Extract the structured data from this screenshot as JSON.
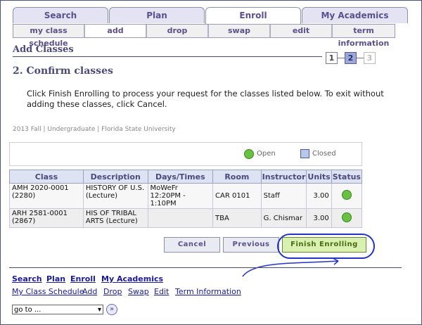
{
  "tabs": [
    {
      "label": "Search",
      "active": false
    },
    {
      "label": "Plan",
      "active": false
    },
    {
      "label": "Enroll",
      "active": true
    },
    {
      "label": "My Academics",
      "active": false
    }
  ],
  "subnav": [
    {
      "label": "my class schedule",
      "active": false
    },
    {
      "label": "add",
      "active": true
    },
    {
      "label": "drop",
      "active": false
    },
    {
      "label": "swap",
      "active": false
    },
    {
      "label": "edit",
      "active": false
    },
    {
      "label": "term information",
      "active": false
    }
  ],
  "page": {
    "title": "Add Classes",
    "steps": [
      "1",
      "2",
      "3"
    ],
    "current_step": 2,
    "subtitle": "2.  Confirm classes",
    "instructions": "Click Finish Enrolling to process your request for the classes listed below. To exit without adding these classes, click Cancel.",
    "term": "2013 Fall | Undergraduate | Florida State University"
  },
  "legend": {
    "open": "Open",
    "closed": "Closed",
    "open_color": "#6ac040",
    "closed_color": "#b8c8e8"
  },
  "table": {
    "headers": {
      "class": "Class",
      "description": "Description",
      "days_times": "Days/Times",
      "room": "Room",
      "instructor": "Instructor",
      "units": "Units",
      "status": "Status"
    },
    "rows": [
      {
        "class": "AMH 2020-0001 (2280)",
        "description": "HISTORY OF U.S. (Lecture)",
        "days_times": "MoWeFr 12:20PM - 1:10PM",
        "room": "CAR 0101",
        "instructor": "Staff",
        "units": "3.00",
        "status": "Open"
      },
      {
        "class": "ARH 2581-0001 (2867)",
        "description": "HIS OF TRIBAL ARTS (Lecture)",
        "days_times": "",
        "room": "TBA",
        "instructor": "G. Chismar",
        "units": "3.00",
        "status": "Open"
      }
    ]
  },
  "buttons": {
    "cancel": "Cancel",
    "previous": "Previous",
    "finish": "Finish Enrolling"
  },
  "footer": {
    "primary_links": [
      "Search",
      "Plan",
      "Enroll",
      "My Academics"
    ],
    "secondary_links": [
      "My Class Schedule",
      "Add",
      "Drop",
      "Swap",
      "Edit",
      "Term Information"
    ],
    "goto": "go to ..."
  },
  "colors": {
    "accent": "#5b4f8e",
    "link": "#1a1a9a",
    "highlight": "#2233cc"
  }
}
